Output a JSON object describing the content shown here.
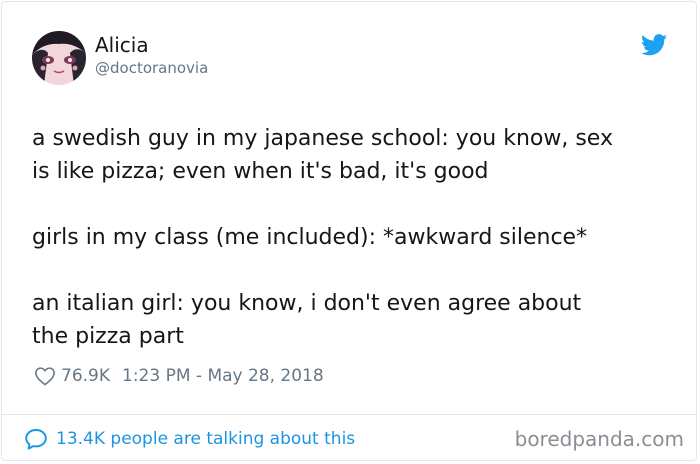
{
  "author": {
    "display_name": "Alicia",
    "handle": "@doctoranovia",
    "avatar_icon": "anime-avatar"
  },
  "brand_icon": "twitter-bird-icon",
  "colors": {
    "twitter_blue": "#1da1f2",
    "link_blue": "#1b95e0",
    "muted_gray": "#657786",
    "text": "#14171a"
  },
  "tweet": {
    "lines": [
      "a swedish guy in my japanese school: you know, sex",
      "is like pizza; even when it's bad, it's good",
      "girls in my class (me included): *awkward silence*",
      "an italian girl: you know, i don't even agree about",
      "the pizza part"
    ]
  },
  "meta": {
    "likes": "76.9K",
    "timestamp": "1:23 PM - May 28, 2018"
  },
  "footer": {
    "talking": "13.4K people are talking about this",
    "watermark": "boredpanda.com"
  }
}
